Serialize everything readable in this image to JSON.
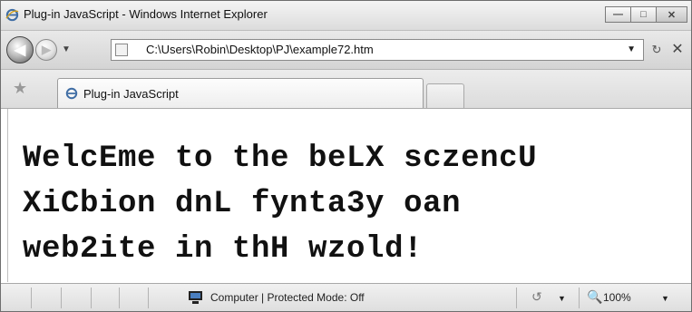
{
  "window": {
    "title": "Plug-in JavaScript - Windows Internet Explorer",
    "controls": {
      "minimize": "—",
      "maximize": "□",
      "close": "✕"
    }
  },
  "navigation": {
    "back_glyph": "◀",
    "forward_glyph": "▶",
    "address": "C:\\Users\\Robin\\Desktop\\PJ\\example72.htm",
    "refresh_glyph": "↻",
    "stop_glyph": "✕",
    "dropdown_glyph": "▼"
  },
  "tabs": [
    {
      "label": "Plug-in JavaScript",
      "active": true
    }
  ],
  "content": {
    "lines": [
      "WelcEme to the beLX sczencU",
      "XiCbion dnL fynta3y oan",
      "web2ite in thH wzold!"
    ]
  },
  "status_bar": {
    "zone": "Computer | Protected Mode: Off",
    "zoom": "100%"
  },
  "icons": {
    "favorites": "★",
    "zoom": "🔍",
    "security": "↺"
  },
  "colors": {
    "accent": "#1f5fa8",
    "chrome": "#dcdcdc"
  }
}
